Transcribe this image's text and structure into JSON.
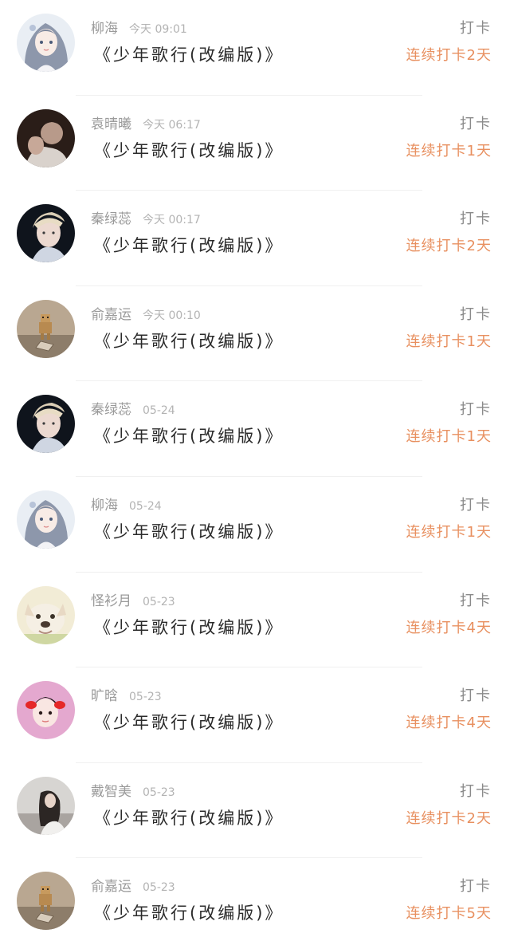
{
  "colors": {
    "streak": "#e89060",
    "name": "#9a9a9a",
    "time": "#b3b3b3",
    "song": "#2b2b2b",
    "action": "#8a8a8a"
  },
  "items": [
    {
      "name": "柳海",
      "time": "今天 09:01",
      "song": "《少年歌行(改编版)》",
      "action": "打卡",
      "streak": "连续打卡2天",
      "avatar": "anime-girl-avatar"
    },
    {
      "name": "袁晴曦",
      "time": "今天 06:17",
      "song": "《少年歌行(改编版)》",
      "action": "打卡",
      "streak": "连续打卡1天",
      "avatar": "couple-photo-avatar"
    },
    {
      "name": "秦绿蕊",
      "time": "今天 00:17",
      "song": "《少年歌行(改编版)》",
      "action": "打卡",
      "streak": "连续打卡2天",
      "avatar": "blond-man-avatar"
    },
    {
      "name": "俞嘉运",
      "time": "今天 00:10",
      "song": "《少年歌行(改编版)》",
      "action": "打卡",
      "streak": "连续打卡1天",
      "avatar": "cardboard-robot-avatar"
    },
    {
      "name": "秦绿蕊",
      "time": "05-24",
      "song": "《少年歌行(改编版)》",
      "action": "打卡",
      "streak": "连续打卡1天",
      "avatar": "blond-man-avatar"
    },
    {
      "name": "柳海",
      "time": "05-24",
      "song": "《少年歌行(改编版)》",
      "action": "打卡",
      "streak": "连续打卡1天",
      "avatar": "anime-girl-avatar"
    },
    {
      "name": "怪衫月",
      "time": "05-23",
      "song": "《少年歌行(改编版)》",
      "action": "打卡",
      "streak": "连续打卡4天",
      "avatar": "bulldog-avatar"
    },
    {
      "name": "旷晗",
      "time": "05-23",
      "song": "《少年歌行(改编版)》",
      "action": "打卡",
      "streak": "连续打卡4天",
      "avatar": "child-avatar"
    },
    {
      "name": "戴智美",
      "time": "05-23",
      "song": "《少年歌行(改编版)》",
      "action": "打卡",
      "streak": "连续打卡2天",
      "avatar": "woman-portrait-avatar"
    },
    {
      "name": "俞嘉运",
      "time": "05-23",
      "song": "《少年歌行(改编版)》",
      "action": "打卡",
      "streak": "连续打卡5天",
      "avatar": "cardboard-robot-avatar"
    }
  ]
}
